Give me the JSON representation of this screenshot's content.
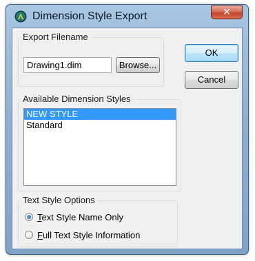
{
  "window": {
    "title": "Dimension Style Export",
    "close_label": "✕"
  },
  "export_filename": {
    "group_label": "Export Filename",
    "value": "Drawing1.dim",
    "browse_label": "Browse..."
  },
  "buttons": {
    "ok_label": "OK",
    "cancel_label": "Cancel"
  },
  "styles": {
    "group_label": "Available Dimension Styles",
    "items": [
      "NEW STYLE",
      "Standard"
    ],
    "selected": "NEW STYLE"
  },
  "text_options": {
    "group_label": "Text Style Options",
    "options": [
      "Text Style Name Only",
      "Full Text Style Information"
    ],
    "selected": "Text Style Name Only"
  },
  "colors": {
    "accent": "#3399ff",
    "title_bar": "#8fb0d2",
    "close_button": "#c2432b"
  },
  "icons": {
    "app": "autocad-app-icon",
    "close": "close-icon"
  }
}
